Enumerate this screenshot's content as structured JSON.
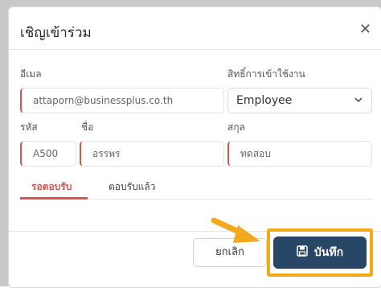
{
  "dialog": {
    "title": "เชิญเข้าร่วม",
    "close_icon": "✕"
  },
  "form": {
    "email_label": "อีเมล",
    "email_value": "attaporn@businessplus.co.th",
    "role_label": "สิทธิ์การเข้าใช้งาน",
    "role_value": "Employee",
    "code_label": "รหัส",
    "code_value": "A500",
    "first_name_label": "ชื่อ",
    "first_name_value": "อรรพร",
    "last_name_label": "สกุล",
    "last_name_value": "ทดสอบ"
  },
  "tabs": [
    {
      "label": "รอตอบรับ",
      "active": true
    },
    {
      "label": "ตอบรับแล้ว",
      "active": false
    }
  ],
  "footer": {
    "cancel_label": "ยกเลิก",
    "save_label": "บันทึก"
  },
  "colors": {
    "accent_red": "#d9534f",
    "primary_button": "#284767",
    "highlight": "#f2a91b"
  },
  "icons": {
    "save": "floppy-disk-icon",
    "close": "close-icon",
    "dropdown": "chevron-down-icon",
    "pointer": "arrow-icon"
  }
}
